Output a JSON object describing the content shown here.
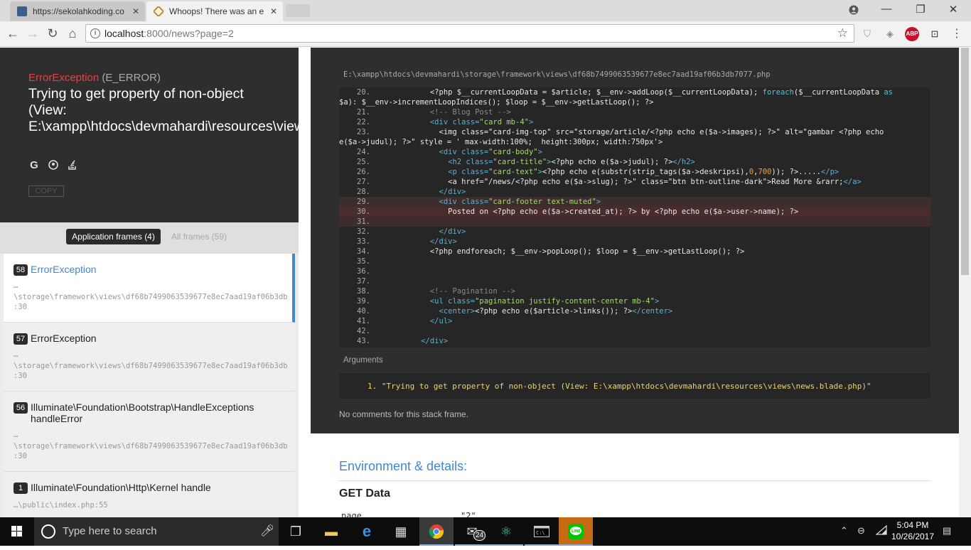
{
  "browser": {
    "tabs": [
      {
        "title": "https://sekolahkoding.co",
        "active": false
      },
      {
        "title": "Whoops! There was an e",
        "active": true
      }
    ],
    "url_host": "localhost",
    "url_path": ":8000/news?page=2",
    "ext_abp": "ABP"
  },
  "error": {
    "class_name": "ErrorException",
    "type": "(E_ERROR)",
    "message": "Trying to get property of non-object (View: E:\\xampp\\htdocs\\devmahardi\\resources\\views\\news.blade.php)",
    "copy_label": "COPY"
  },
  "frames_tabs": {
    "application": "Application frames (4)",
    "all": "All frames (59)"
  },
  "frames": [
    {
      "num": "58",
      "title": "ErrorException",
      "path1": "…",
      "path2": "\\storage\\framework\\views\\df68b7499063539677e8ec7aad19af06b3db",
      "line": ":30"
    },
    {
      "num": "57",
      "title": "ErrorException",
      "path1": "…",
      "path2": "\\storage\\framework\\views\\df68b7499063539677e8ec7aad19af06b3db",
      "line": ":30"
    },
    {
      "num": "56",
      "title": "Illuminate\\Foundation\\Bootstrap\\HandleExceptions handleError",
      "path1": "…",
      "path2": "\\storage\\framework\\views\\df68b7499063539677e8ec7aad19af06b3db",
      "line": ":30"
    },
    {
      "num": "1",
      "title": "Illuminate\\Foundation\\Http\\Kernel handle",
      "path1": "…\\public\\index.php:55",
      "path2": "",
      "line": ""
    }
  ],
  "code": {
    "file": "E:\\xampp\\htdocs\\devmahardi\\storage\\framework\\views\\df68b7499063539677e8ec7aad19af06b3db7077.php",
    "highlight_line": "30"
  },
  "arguments": {
    "label": "Arguments",
    "items": [
      "1. \"Trying to get property of non-object (View: E:\\xampp\\htdocs\\devmahardi\\resources\\views\\news.blade.php)\""
    ]
  },
  "no_comments": "No comments for this stack frame.",
  "environment": {
    "title": "Environment & details:",
    "get_title": "GET Data",
    "get_key": "page",
    "get_value": "\"2\""
  },
  "taskbar": {
    "search_placeholder": "Type here to search",
    "mail_badge": "24",
    "time": "5:04 PM",
    "date": "10/26/2017"
  }
}
